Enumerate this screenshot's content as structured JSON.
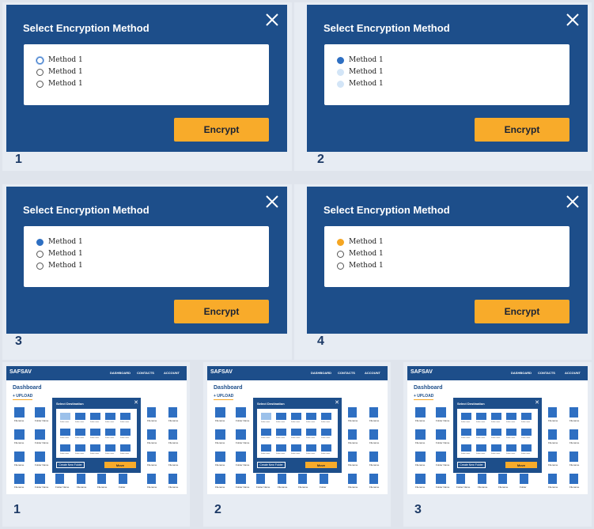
{
  "dialogs": [
    {
      "step": "1",
      "title": "Select Encryption Method",
      "options": [
        "Method 1",
        "Method 1",
        "Method 1"
      ],
      "button": "Encrypt",
      "radio_states": [
        "focus",
        "empty",
        "empty"
      ]
    },
    {
      "step": "2",
      "title": "Select Encryption Method",
      "options": [
        "Method 1",
        "Method 1",
        "Method 1"
      ],
      "button": "Encrypt",
      "radio_states": [
        "selected-blue",
        "faint",
        "faint"
      ]
    },
    {
      "step": "3",
      "title": "Select Encryption Method",
      "options": [
        "Method 1",
        "Method 1",
        "Method 1"
      ],
      "button": "Encrypt",
      "radio_states": [
        "selected-blue",
        "empty",
        "empty"
      ]
    },
    {
      "step": "4",
      "title": "Select Encryption Method",
      "options": [
        "Method 1",
        "Method 1",
        "Method 1"
      ],
      "button": "Encrypt",
      "radio_states": [
        "selected-orange",
        "empty",
        "empty"
      ]
    }
  ],
  "screens": [
    {
      "step": "1",
      "highlight_index": 0
    },
    {
      "step": "2",
      "highlight_index": 0
    },
    {
      "step": "3",
      "highlight_index": -1
    }
  ],
  "app": {
    "logo": "SAFSAV",
    "nav": [
      "DASHBOARD",
      "CONTACTS",
      "ACCOUNT"
    ],
    "page_title": "Dashboard",
    "upload": "+ UPLOAD",
    "file_labels": [
      "Filename",
      "Folder Name"
    ],
    "bottom_labels": [
      "Filename",
      "Folder Name",
      "Filename",
      "Filename",
      "Folder",
      "Filename"
    ],
    "modal_title": "Select Destination",
    "modal_new_folder": "Create New Folder",
    "modal_move": "Move",
    "modal_folder_label": "Folder name"
  },
  "colors": {
    "primary": "#1d4e8a",
    "accent": "#f8ab2a",
    "radio_blue": "#2e6fc2"
  }
}
